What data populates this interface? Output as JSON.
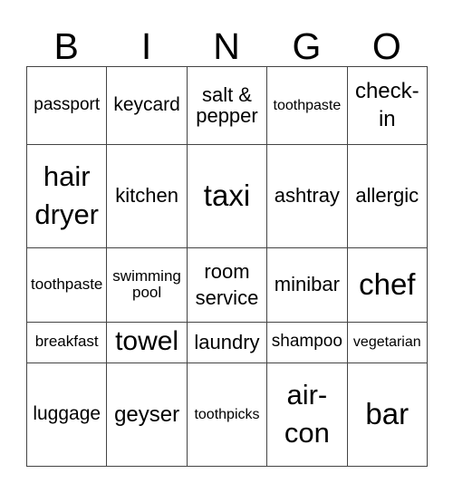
{
  "header": {
    "letters": [
      "B",
      "I",
      "N",
      "G",
      "O"
    ]
  },
  "grid": {
    "rows": [
      [
        "passport",
        "keycard",
        "salt & pepper",
        "toothpaste",
        "check-in"
      ],
      [
        "hair dryer",
        "kitchen",
        "taxi",
        "ashtray",
        "allergic"
      ],
      [
        "toothpaste",
        "swimming pool",
        "room service",
        "minibar",
        "chef"
      ],
      [
        "breakfast",
        "towel",
        "laundry",
        "shampoo",
        "vegetarian"
      ],
      [
        "luggage",
        "geyser",
        "toothpicks",
        "air-con",
        "bar"
      ]
    ]
  }
}
